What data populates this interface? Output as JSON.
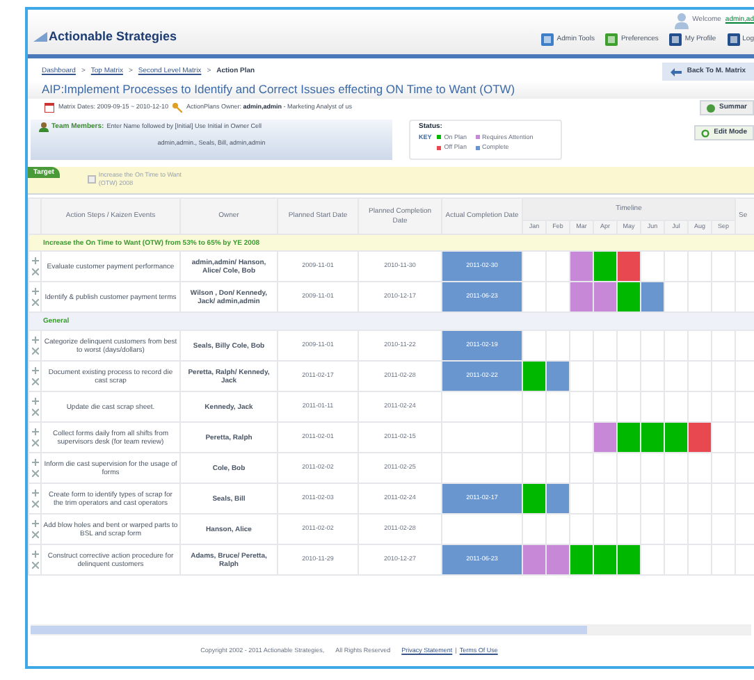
{
  "header": {
    "logo": "Actionable Strategies",
    "welcome": "Welcome",
    "user": "admin,ad",
    "nav": [
      {
        "label": "Admin Tools",
        "kind": "tools"
      },
      {
        "label": "Preferences",
        "kind": "preferences"
      },
      {
        "label": "My Profile",
        "kind": "profile"
      },
      {
        "label": "Log",
        "kind": "logout"
      }
    ]
  },
  "breadcrumbs": [
    {
      "label": "Dashboard",
      "current": false
    },
    {
      "separator": ">",
      "label": "Top Matrix",
      "current": false
    },
    {
      "separator": ">",
      "label": "Second Level Matrix",
      "current": false
    },
    {
      "separator": ">",
      "label": "Action Plan",
      "current": true
    }
  ],
  "back_button": "Back To M. Matrix",
  "title": "AIP:Implement Processes to Identify and Correct Issues effecting ON Time to Want (OTW)",
  "meta": {
    "dates_label": "Matrix Dates:",
    "dates": "2009-09-15 ~ 2010-12-10",
    "owner_label": "ActionPlans Owner:",
    "owner": "admin,admin",
    "owner_note": "- Marketing Analyst of us"
  },
  "summary_button": "Summar",
  "edit_button": "Edit Mode",
  "team": {
    "label": "Team Members:",
    "hint": "Enter Name followed by [Initial] Use Initial in Owner Cell",
    "members": "admin,admin., Seals, Bill, admin,admin"
  },
  "status_key": {
    "title": "Status:",
    "key": "KEY",
    "items": [
      {
        "label": "On Plan",
        "color": "#00b800"
      },
      {
        "label": "Requires Attention",
        "color": "#c888d8"
      },
      {
        "label": "Off Plan",
        "color": "#e84850"
      },
      {
        "label": "Complete",
        "color": "#6a96d0"
      }
    ]
  },
  "target": {
    "tab": "Target",
    "text": "Increase the On Time to Want (OTW) 2008"
  },
  "table": {
    "columns": [
      "Action Steps / Kaizen Events",
      "Owner",
      "Planned Start Date",
      "Planned Completion Date",
      "Actual Completion Date"
    ],
    "timeline_label": "Timeline",
    "months": [
      "Jan",
      "Feb",
      "Mar",
      "Apr",
      "May",
      "Jun",
      "Jul",
      "Aug",
      "Sep"
    ],
    "cut_column": "Se",
    "groups": [
      {
        "kind": "target",
        "title": "Increase the On Time to Want (OTW) from 53% to 65% by YE 2008",
        "rows": [
          {
            "step": "Evaluate customer payment performance",
            "owner": "admin,admin/ Hanson, Alice/ Cole, Bob",
            "start": "2009-11-01",
            "planned": "2010-11-30",
            "actual": "2011-02-30",
            "timeline": [
              {
                "color": "#ffffff"
              },
              {
                "color": "#ffffff"
              },
              {
                "color": "#c888d8"
              },
              {
                "color": "#00b800"
              },
              {
                "color": "#e84850"
              },
              {
                "color": "#ffffff"
              },
              {
                "color": "#ffffff"
              },
              {
                "color": "#ffffff"
              },
              {
                "color": "#ffffff"
              }
            ]
          },
          {
            "step": "Identify & publish customer payment terms",
            "owner": "Wilson , Don/ Kennedy, Jack/ admin,admin",
            "start": "2009-11-01",
            "planned": "2010-12-17",
            "actual": "2011-06-23",
            "timeline": [
              {
                "color": "#ffffff"
              },
              {
                "color": "#ffffff"
              },
              {
                "color": "#c888d8"
              },
              {
                "color": "#c888d8"
              },
              {
                "color": "#00b800"
              },
              {
                "color": "#6a96d0"
              },
              {
                "color": "#ffffff"
              },
              {
                "color": "#ffffff"
              },
              {
                "color": "#ffffff"
              }
            ]
          }
        ]
      },
      {
        "kind": "category",
        "title": "General",
        "rows": [
          {
            "step": "Categorize delinquent customers from best to worst (days/dollars)",
            "owner": "Seals, Billy Cole, Bob",
            "start": "2009-11-01",
            "planned": "2010-11-22",
            "actual": "2011-02-19",
            "timeline": [
              {
                "color": "#ffffff"
              },
              {
                "color": "#ffffff"
              },
              {
                "color": "#ffffff"
              },
              {
                "color": "#ffffff"
              },
              {
                "color": "#ffffff"
              },
              {
                "color": "#ffffff"
              },
              {
                "color": "#ffffff"
              },
              {
                "color": "#ffffff"
              },
              {
                "color": "#ffffff"
              }
            ]
          },
          {
            "step": "Document existing process to record die cast scrap",
            "owner": "Peretta, Ralph/ Kennedy, Jack",
            "start": "2011-02-17",
            "planned": "2011-02-28",
            "actual": "2011-02-22",
            "timeline": [
              {
                "color": "#00b800"
              },
              {
                "color": "#6a96d0"
              },
              {
                "color": "#ffffff"
              },
              {
                "color": "#ffffff"
              },
              {
                "color": "#ffffff"
              },
              {
                "color": "#ffffff"
              },
              {
                "color": "#ffffff"
              },
              {
                "color": "#ffffff"
              },
              {
                "color": "#ffffff"
              }
            ]
          },
          {
            "step": "Update die cast scrap sheet.",
            "owner": "Kennedy, Jack",
            "start": "2011-01-11",
            "planned": "2011-02-24",
            "timeline": [
              {
                "color": "#ffffff"
              },
              {
                "color": "#ffffff"
              },
              {
                "color": "#ffffff"
              },
              {
                "color": "#ffffff"
              },
              {
                "color": "#ffffff"
              },
              {
                "color": "#ffffff"
              },
              {
                "color": "#ffffff"
              },
              {
                "color": "#ffffff"
              },
              {
                "color": "#ffffff"
              }
            ]
          },
          {
            "step": "Collect forms daily from all shifts from supervisors desk (for team review)",
            "owner": "Peretta, Ralph",
            "start": "2011-02-01",
            "planned": "2011-02-15",
            "timeline": [
              {
                "color": "#ffffff"
              },
              {
                "color": "#ffffff"
              },
              {
                "color": "#ffffff"
              },
              {
                "color": "#c888d8"
              },
              {
                "color": "#00b800"
              },
              {
                "color": "#00b800"
              },
              {
                "color": "#00b800"
              },
              {
                "color": "#e84850"
              },
              {
                "color": "#ffffff"
              }
            ]
          },
          {
            "step": "Inform die cast supervision for the usage of forms",
            "owner": "Cole, Bob",
            "start": "2011-02-02",
            "planned": "2011-02-25",
            "timeline": [
              {
                "color": "#ffffff"
              },
              {
                "color": "#ffffff"
              },
              {
                "color": "#ffffff"
              },
              {
                "color": "#ffffff"
              },
              {
                "color": "#ffffff"
              },
              {
                "color": "#ffffff"
              },
              {
                "color": "#ffffff"
              },
              {
                "color": "#ffffff"
              },
              {
                "color": "#ffffff"
              }
            ]
          },
          {
            "step": "Create form to identify types of scrap for the trim operators and cast operators",
            "owner": "Seals, Bill",
            "start": "2011-02-03",
            "planned": "2011-02-24",
            "actual": "2011-02-17",
            "timeline": [
              {
                "color": "#00b800"
              },
              {
                "color": "#6a96d0"
              },
              {
                "color": "#ffffff"
              },
              {
                "color": "#ffffff"
              },
              {
                "color": "#ffffff"
              },
              {
                "color": "#ffffff"
              },
              {
                "color": "#ffffff"
              },
              {
                "color": "#ffffff"
              },
              {
                "color": "#ffffff"
              }
            ]
          },
          {
            "step": "Add blow holes and bent or warped parts to BSL and scrap form",
            "owner": "Hanson, Alice",
            "start": "2011-02-02",
            "planned": "2011-02-28",
            "timeline": [
              {
                "color": "#ffffff"
              },
              {
                "color": "#ffffff"
              },
              {
                "color": "#ffffff"
              },
              {
                "color": "#ffffff"
              },
              {
                "color": "#ffffff"
              },
              {
                "color": "#ffffff"
              },
              {
                "color": "#ffffff"
              },
              {
                "color": "#ffffff"
              },
              {
                "color": "#ffffff"
              }
            ]
          },
          {
            "step": "Construct corrective action procedure for delinquent customers",
            "owner": "Adams, Bruce/ Peretta, Ralph",
            "start": "2010-11-29",
            "planned": "2010-12-27",
            "actual": "2011-06-23",
            "timeline": [
              {
                "color": "#c888d8"
              },
              {
                "color": "#c888d8"
              },
              {
                "color": "#00b800"
              },
              {
                "color": "#00b800"
              },
              {
                "color": "#00b800"
              },
              {
                "color": "#ffffff"
              },
              {
                "color": "#ffffff"
              },
              {
                "color": "#ffffff"
              },
              {
                "color": "#ffffff"
              }
            ]
          }
        ]
      }
    ]
  },
  "footer": {
    "copyright": "Copyright 2002 - 2011 Actionable Strategies,",
    "rights": "All Rights Reserved",
    "links": [
      {
        "label": "Privacy Statement"
      },
      {
        "separator": "|",
        "label": "Terms Of Use"
      }
    ]
  }
}
